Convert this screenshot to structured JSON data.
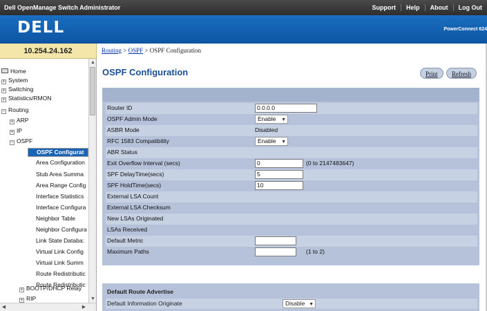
{
  "topbar": {
    "app_title": "Dell OpenManage Switch Administrator",
    "links": [
      "Support",
      "Help",
      "About",
      "Log Out"
    ]
  },
  "banner": {
    "logo": "DELL",
    "product": "PowerConnect 624"
  },
  "ip_address": "10.254.24.162",
  "sidebar": {
    "items": [
      {
        "label": "Home",
        "icon": "home-icon"
      },
      {
        "label": "System",
        "icon": "expand-icon"
      },
      {
        "label": "Switching",
        "icon": "expand-icon"
      },
      {
        "label": "Statistics/RMON",
        "icon": "expand-icon"
      },
      {
        "label": "Routing",
        "icon": "collapse-icon"
      },
      {
        "label": "ARP",
        "icon": "expand-icon"
      },
      {
        "label": "IP",
        "icon": "expand-icon"
      },
      {
        "label": "OSPF",
        "icon": "collapse-icon"
      },
      {
        "label": "OSPF Configurat",
        "selected": true
      },
      {
        "label": "Area Configuration"
      },
      {
        "label": "Stub Area Summa"
      },
      {
        "label": "Area Range Config"
      },
      {
        "label": "Interface Statistics"
      },
      {
        "label": "Interface Configura"
      },
      {
        "label": "Neighbor Table"
      },
      {
        "label": "Neighbor Configura"
      },
      {
        "label": "Link State Databa:"
      },
      {
        "label": "Virtual Link Config"
      },
      {
        "label": "Virtual Link Summ"
      },
      {
        "label": "Route Redistributic"
      },
      {
        "label": "Route Redistributic"
      },
      {
        "label": "BOOTP/DHCP Relay",
        "icon": "expand-icon"
      },
      {
        "label": "RIP",
        "icon": "expand-icon"
      }
    ]
  },
  "breadcrumb": {
    "routing": "Routing",
    "sep1": " > ",
    "ospf": "OSPF",
    "sep2": " > ",
    "current": "OSPF Configuration"
  },
  "page_title": "OSPF Configuration",
  "buttons": {
    "print": "Print",
    "refresh": "Refresh"
  },
  "form": {
    "rows": [
      {
        "label": "Router ID",
        "type": "input",
        "value": "0.0.0.0"
      },
      {
        "label": "OSPF Admin Mode",
        "type": "select",
        "value": "Enable"
      },
      {
        "label": "ASBR Mode",
        "type": "text",
        "value": "Disabled"
      },
      {
        "label": "RFC 1583 Compatibility",
        "type": "select",
        "value": "Enable"
      },
      {
        "label": "ABR Status",
        "type": "text",
        "value": ""
      },
      {
        "label": "Exit Overflow Interval (secs)",
        "type": "input",
        "value": "0",
        "range": "(0 to 2147483647)"
      },
      {
        "label": "SPF DelayTime(secs)",
        "type": "input",
        "value": "5"
      },
      {
        "label": "SPF HoldTime(secs)",
        "type": "input",
        "value": "10"
      },
      {
        "label": "External LSA Count",
        "type": "text",
        "value": ""
      },
      {
        "label": "External LSA Checksum",
        "type": "text",
        "value": ""
      },
      {
        "label": "New LSAs Originated",
        "type": "text",
        "value": ""
      },
      {
        "label": "LSAs Received",
        "type": "text",
        "value": ""
      },
      {
        "label": "Default Metric",
        "type": "input",
        "value": ""
      },
      {
        "label": "Maximum Paths",
        "type": "input",
        "value": "",
        "range": "(1 to 2)"
      }
    ]
  },
  "default_route": {
    "title": "Default Route Advertise",
    "row_label": "Default Information Originate",
    "row_value": "Disable"
  },
  "colors": {
    "accent": "#1a63b5",
    "banner": "#0d55a3",
    "panel": "#b5c2da",
    "ip_bar": "#f4e6a8"
  }
}
